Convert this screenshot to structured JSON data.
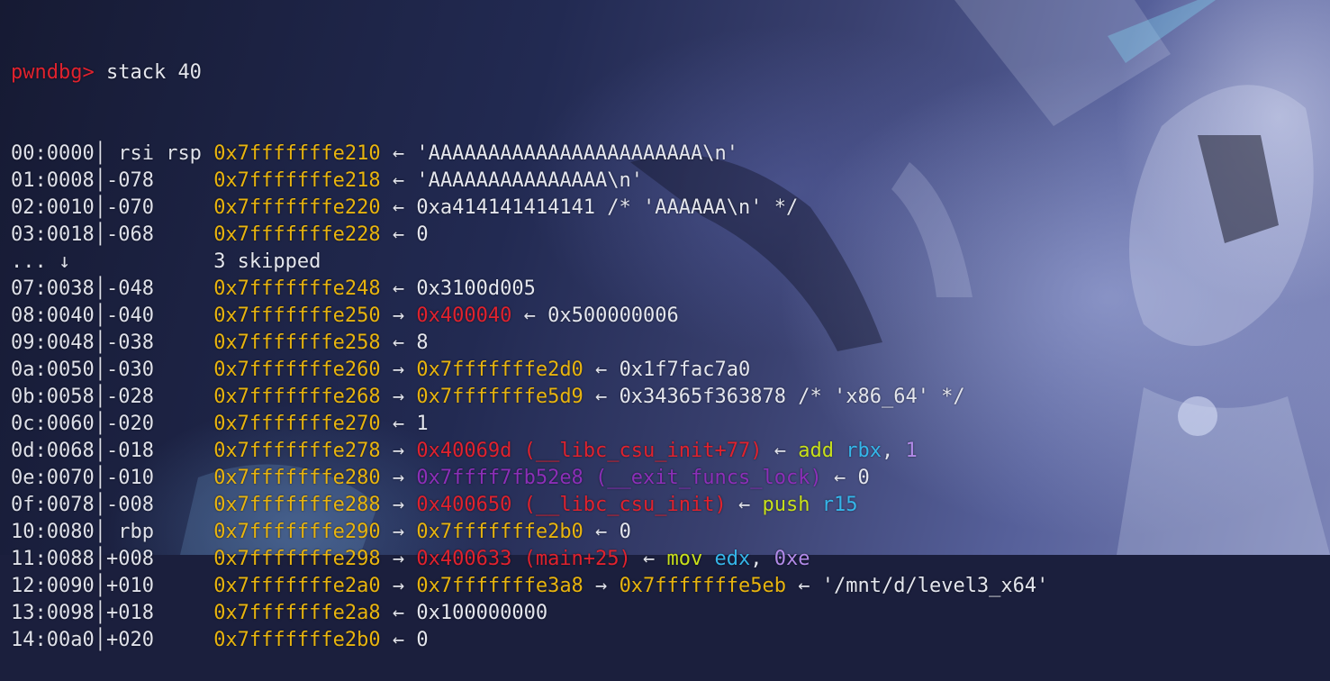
{
  "prompt": {
    "text": "pwndbg>",
    "command": "stack 40"
  },
  "rows": [
    {
      "off": "00:0000",
      "sep": "│",
      "label": " rsi rsp ",
      "addr": "0x7fffffffe210",
      "rest": [
        {
          "t": " ← ",
          "c": "arrow"
        },
        {
          "t": "'AAAAAAAAAAAAAAAAAAAAAAA\\n'",
          "c": "text"
        }
      ]
    },
    {
      "off": "01:0008",
      "sep": "│",
      "label": "-078     ",
      "addr": "0x7fffffffe218",
      "rest": [
        {
          "t": " ← ",
          "c": "arrow"
        },
        {
          "t": "'AAAAAAAAAAAAAAA\\n'",
          "c": "text"
        }
      ]
    },
    {
      "off": "02:0010",
      "sep": "│",
      "label": "-070     ",
      "addr": "0x7fffffffe220",
      "rest": [
        {
          "t": " ← ",
          "c": "arrow"
        },
        {
          "t": "0xa414141414141 /* 'AAAAAA\\n' */",
          "c": "text"
        }
      ]
    },
    {
      "off": "03:0018",
      "sep": "│",
      "label": "-068     ",
      "addr": "0x7fffffffe228",
      "rest": [
        {
          "t": " ← ",
          "c": "arrow"
        },
        {
          "t": "0",
          "c": "text"
        }
      ]
    },
    {
      "off": "... ↓  ",
      "sep": " ",
      "label": "         ",
      "addr": "",
      "rest": [
        {
          "t": "3 skipped",
          "c": "text"
        }
      ]
    },
    {
      "off": "07:0038",
      "sep": "│",
      "label": "-048     ",
      "addr": "0x7fffffffe248",
      "rest": [
        {
          "t": " ← ",
          "c": "arrow"
        },
        {
          "t": "0x3100d005",
          "c": "text"
        }
      ]
    },
    {
      "off": "08:0040",
      "sep": "│",
      "label": "-040     ",
      "addr": "0x7fffffffe250",
      "rest": [
        {
          "t": " → ",
          "c": "arrow"
        },
        {
          "t": "0x400040",
          "c": "code"
        },
        {
          "t": " ← ",
          "c": "arrow"
        },
        {
          "t": "0x500000006",
          "c": "text"
        }
      ]
    },
    {
      "off": "09:0048",
      "sep": "│",
      "label": "-038     ",
      "addr": "0x7fffffffe258",
      "rest": [
        {
          "t": " ← ",
          "c": "arrow"
        },
        {
          "t": "8",
          "c": "text"
        }
      ]
    },
    {
      "off": "0a:0050",
      "sep": "│",
      "label": "-030     ",
      "addr": "0x7fffffffe260",
      "rest": [
        {
          "t": " → ",
          "c": "arrow"
        },
        {
          "t": "0x7fffffffe2d0",
          "c": "addr"
        },
        {
          "t": " ← ",
          "c": "arrow"
        },
        {
          "t": "0x1f7fac7a0",
          "c": "text"
        }
      ]
    },
    {
      "off": "0b:0058",
      "sep": "│",
      "label": "-028     ",
      "addr": "0x7fffffffe268",
      "rest": [
        {
          "t": " → ",
          "c": "arrow"
        },
        {
          "t": "0x7fffffffe5d9",
          "c": "addr"
        },
        {
          "t": " ← ",
          "c": "arrow"
        },
        {
          "t": "0x34365f363878 /* 'x86_64' */",
          "c": "text"
        }
      ]
    },
    {
      "off": "0c:0060",
      "sep": "│",
      "label": "-020     ",
      "addr": "0x7fffffffe270",
      "rest": [
        {
          "t": " ← ",
          "c": "arrow"
        },
        {
          "t": "1",
          "c": "text"
        }
      ]
    },
    {
      "off": "0d:0068",
      "sep": "│",
      "label": "-018     ",
      "addr": "0x7fffffffe278",
      "rest": [
        {
          "t": " → ",
          "c": "arrow"
        },
        {
          "t": "0x40069d (__libc_csu_init+77)",
          "c": "code"
        },
        {
          "t": " ← ",
          "c": "arrow"
        },
        {
          "t": "add",
          "c": "instr"
        },
        {
          "t": " ",
          "c": "text"
        },
        {
          "t": "rbx",
          "c": "reg"
        },
        {
          "t": ", ",
          "c": "text"
        },
        {
          "t": "1",
          "c": "imm"
        }
      ]
    },
    {
      "off": "0e:0070",
      "sep": "│",
      "label": "-010     ",
      "addr": "0x7fffffffe280",
      "rest": [
        {
          "t": " → ",
          "c": "arrow"
        },
        {
          "t": "0x7ffff7fb52e8 (__exit_funcs_lock)",
          "c": "data"
        },
        {
          "t": " ← ",
          "c": "arrow"
        },
        {
          "t": "0",
          "c": "text"
        }
      ]
    },
    {
      "off": "0f:0078",
      "sep": "│",
      "label": "-008     ",
      "addr": "0x7fffffffe288",
      "rest": [
        {
          "t": " → ",
          "c": "arrow"
        },
        {
          "t": "0x400650 (__libc_csu_init)",
          "c": "code"
        },
        {
          "t": " ← ",
          "c": "arrow"
        },
        {
          "t": "push",
          "c": "instr"
        },
        {
          "t": " ",
          "c": "text"
        },
        {
          "t": "r15",
          "c": "reg"
        }
      ]
    },
    {
      "off": "10:0080",
      "sep": "│",
      "label": " rbp     ",
      "addr": "0x7fffffffe290",
      "rest": [
        {
          "t": " → ",
          "c": "arrow"
        },
        {
          "t": "0x7fffffffe2b0",
          "c": "addr"
        },
        {
          "t": " ← ",
          "c": "arrow"
        },
        {
          "t": "0",
          "c": "text"
        }
      ]
    },
    {
      "off": "11:0088",
      "sep": "│",
      "label": "+008     ",
      "addr": "0x7fffffffe298",
      "rest": [
        {
          "t": " → ",
          "c": "arrow"
        },
        {
          "t": "0x400633 (main+25)",
          "c": "code"
        },
        {
          "t": " ← ",
          "c": "arrow"
        },
        {
          "t": "mov",
          "c": "instr"
        },
        {
          "t": " ",
          "c": "text"
        },
        {
          "t": "edx",
          "c": "reg"
        },
        {
          "t": ", ",
          "c": "text"
        },
        {
          "t": "0xe",
          "c": "imm"
        }
      ]
    },
    {
      "off": "12:0090",
      "sep": "│",
      "label": "+010     ",
      "addr": "0x7fffffffe2a0",
      "rest": [
        {
          "t": " → ",
          "c": "arrow"
        },
        {
          "t": "0x7fffffffe3a8",
          "c": "addr"
        },
        {
          "t": " → ",
          "c": "arrow"
        },
        {
          "t": "0x7fffffffe5eb",
          "c": "addr"
        },
        {
          "t": " ← ",
          "c": "arrow"
        },
        {
          "t": "'/mnt/d/level3_x64'",
          "c": "text"
        }
      ]
    },
    {
      "off": "13:0098",
      "sep": "│",
      "label": "+018     ",
      "addr": "0x7fffffffe2a8",
      "rest": [
        {
          "t": " ← ",
          "c": "arrow"
        },
        {
          "t": "0x100000000",
          "c": "text"
        }
      ]
    },
    {
      "off": "14:00a0",
      "sep": "│",
      "label": "+020     ",
      "addr": "0x7fffffffe2b0",
      "rest": [
        {
          "t": " ← ",
          "c": "arrow"
        },
        {
          "t": "0",
          "c": "text"
        }
      ]
    }
  ]
}
